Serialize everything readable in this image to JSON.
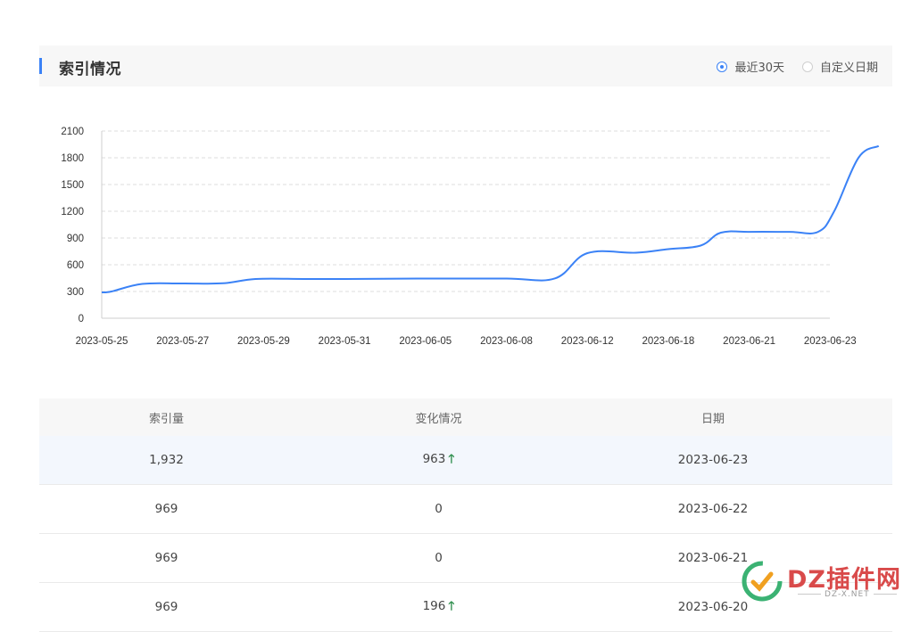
{
  "header": {
    "title": "索引情况",
    "options": [
      {
        "label": "最近30天",
        "selected": true
      },
      {
        "label": "自定义日期",
        "selected": false
      }
    ]
  },
  "chart_data": {
    "type": "line",
    "x": [
      "2023-05-25",
      "2023-05-27",
      "2023-05-29",
      "2023-05-31",
      "2023-06-05",
      "2023-06-08",
      "2023-06-12",
      "2023-06-18",
      "2023-06-21",
      "2023-06-23"
    ],
    "y_ticks": [
      0,
      300,
      600,
      900,
      1200,
      1500,
      1800,
      2100
    ],
    "ylim": [
      0,
      2100
    ],
    "grid": true,
    "color": "#3b82f6",
    "series": [
      {
        "values": [
          {
            "i": 0,
            "v": 290
          },
          {
            "i": 0.12,
            "v": 300
          },
          {
            "i": 0.5,
            "v": 385
          },
          {
            "i": 1,
            "v": 390
          },
          {
            "i": 1.5,
            "v": 392
          },
          {
            "i": 1.9,
            "v": 440
          },
          {
            "i": 2.5,
            "v": 440
          },
          {
            "i": 3,
            "v": 440
          },
          {
            "i": 4,
            "v": 445
          },
          {
            "i": 5,
            "v": 445
          },
          {
            "i": 5.6,
            "v": 447
          },
          {
            "i": 6,
            "v": 730
          },
          {
            "i": 6.6,
            "v": 735
          },
          {
            "i": 7,
            "v": 775
          },
          {
            "i": 7.4,
            "v": 815
          },
          {
            "i": 7.65,
            "v": 960
          },
          {
            "i": 8,
            "v": 969
          },
          {
            "i": 8.5,
            "v": 969
          },
          {
            "i": 8.85,
            "v": 969
          },
          {
            "i": 9.05,
            "v": 1200
          },
          {
            "i": 9.35,
            "v": 1800
          },
          {
            "i": 9.6,
            "v": 1932
          }
        ]
      }
    ]
  },
  "table": {
    "columns": [
      "索引量",
      "变化情况",
      "日期"
    ],
    "rows": [
      {
        "count": "1,932",
        "change": "963",
        "up": true,
        "date": "2023-06-23"
      },
      {
        "count": "969",
        "change": "0",
        "up": false,
        "date": "2023-06-22"
      },
      {
        "count": "969",
        "change": "0",
        "up": false,
        "date": "2023-06-21"
      },
      {
        "count": "969",
        "change": "196",
        "up": true,
        "date": "2023-06-20"
      }
    ]
  },
  "watermark": {
    "logo": "DZ插件网",
    "sub": "DZ-X.NET"
  }
}
